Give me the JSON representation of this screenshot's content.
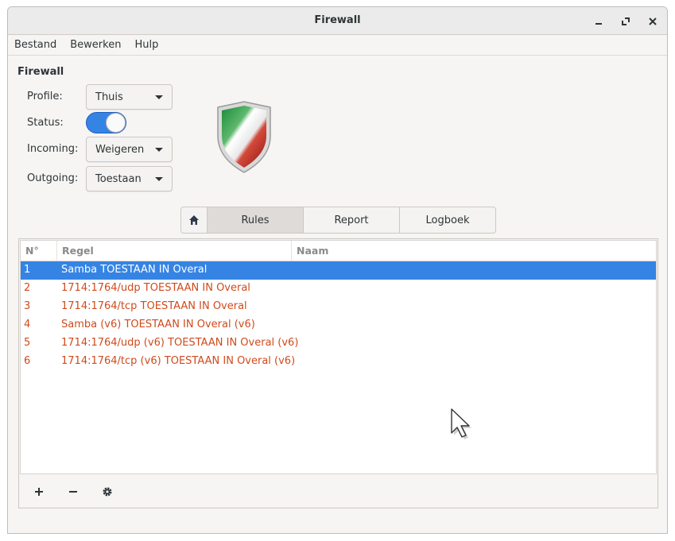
{
  "window": {
    "title": "Firewall"
  },
  "menu": [
    "Bestand",
    "Bewerken",
    "Hulp"
  ],
  "section_title": "Firewall",
  "fields": {
    "profile": {
      "label": "Profile:",
      "value": "Thuis"
    },
    "status": {
      "label": "Status:",
      "enabled": true
    },
    "incoming": {
      "label": "Incoming:",
      "value": "Weigeren"
    },
    "outgoing": {
      "label": "Outgoing:",
      "value": "Toestaan"
    }
  },
  "tabs": [
    {
      "label": "Rules",
      "active": true
    },
    {
      "label": "Report",
      "active": false
    },
    {
      "label": "Logboek",
      "active": false
    }
  ],
  "table": {
    "columns": [
      "N°",
      "Regel",
      "Naam"
    ],
    "rows": [
      {
        "n": "1",
        "rule": "Samba TOESTAAN IN Overal",
        "name": "",
        "selected": true
      },
      {
        "n": "2",
        "rule": "1714:1764/udp TOESTAAN IN Overal",
        "name": ""
      },
      {
        "n": "3",
        "rule": "1714:1764/tcp TOESTAAN IN Overal",
        "name": ""
      },
      {
        "n": "4",
        "rule": "Samba (v6) TOESTAAN IN Overal (v6)",
        "name": ""
      },
      {
        "n": "5",
        "rule": "1714:1764/udp (v6) TOESTAAN IN Overal (v6)",
        "name": ""
      },
      {
        "n": "6",
        "rule": "1714:1764/tcp (v6) TOESTAAN IN Overal (v6)",
        "name": ""
      }
    ]
  },
  "colors": {
    "accent": "#3584e4",
    "rule_text": "#d04a1c"
  },
  "icons": [
    "minimize-icon",
    "maximize-icon",
    "close-icon",
    "home-icon",
    "add-icon",
    "remove-icon",
    "gear-icon",
    "shield-icon",
    "mouse-cursor-icon"
  ]
}
